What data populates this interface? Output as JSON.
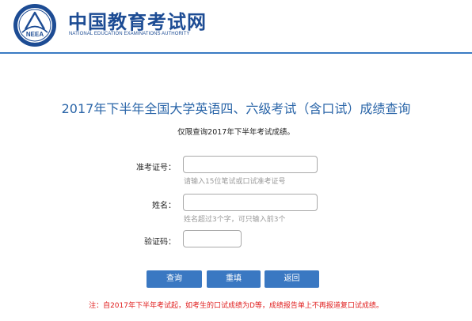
{
  "header": {
    "brand_cn": "中国教育考试网",
    "brand_en": "NATIONAL EDUCATION EXAMINATIONS AUTHORITY",
    "logo_text": "NEEA",
    "logo_icon": "neea-emblem-icon",
    "brand_color": "#1d4c94",
    "divider_color": "#3a7bc3"
  },
  "main": {
    "title": "2017年下半年全国大学英语四、六级考试（含口试）成绩查询",
    "subtitle": "仅限查询2017年下半年考试成绩。",
    "title_color": "#2a65a8"
  },
  "form": {
    "exam_id": {
      "label": "准考证号：",
      "value": "",
      "placeholder": "",
      "hint": "请输入15位笔试或口试准考证号"
    },
    "name": {
      "label": "姓名：",
      "value": "",
      "placeholder": "",
      "hint": "姓名超过3个字，可只输入前3个"
    },
    "captcha": {
      "label": "验证码：",
      "value": "",
      "placeholder": ""
    }
  },
  "buttons": {
    "query": "查询",
    "reset": "重填",
    "back": "返回",
    "color": "#3a78c2"
  },
  "note": {
    "text": "注：自2017年下半年考试起，如考生的口试成绩为D等，成绩报告单上不再报道复口试成绩。",
    "color": "#e02020"
  }
}
